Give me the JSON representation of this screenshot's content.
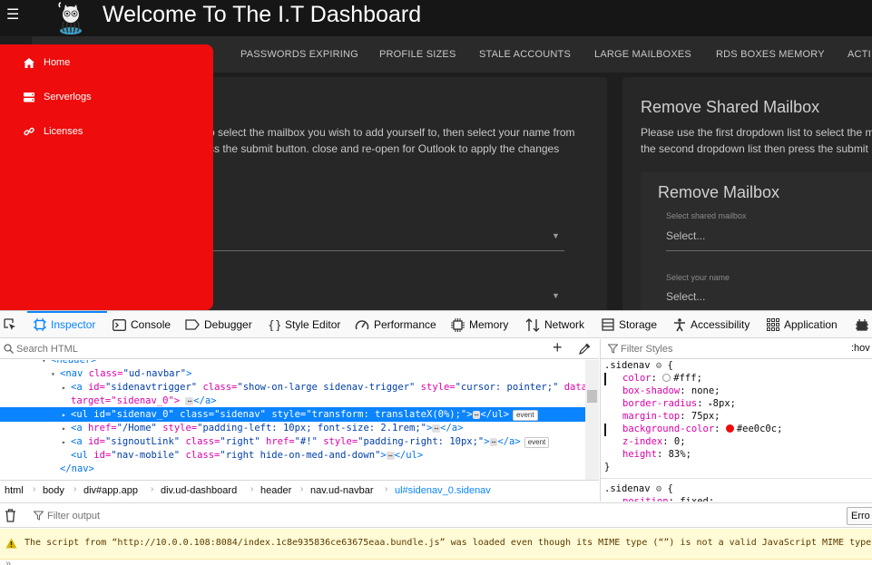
{
  "page": {
    "title": "Welcome To The I.T Dashboard",
    "tabs": [
      "PASSWORDS EXPIRING",
      "PROFILE SIZES",
      "STALE ACCOUNTS",
      "LARGE MAILBOXES",
      "RDS BOXES MEMORY",
      "ACTI"
    ],
    "sidenav": [
      {
        "label": "Home",
        "icon": "home-icon"
      },
      {
        "label": "Serverlogs",
        "icon": "server-icon"
      },
      {
        "label": "Licenses",
        "icon": "link-icon"
      }
    ],
    "left_card": {
      "line1": "o select the mailbox you wish to add yourself to, then select your name from",
      "line2": "ss the submit button. close and re-open for Outlook to apply the changes"
    },
    "right_card": {
      "title": "Remove Shared Mailbox",
      "line1": "Please use the first dropdown list to select the m",
      "line2": "the second dropdown list then press the submit",
      "subtitle": "Remove Mailbox",
      "field1_label": "Select shared mailbox",
      "field1_value": "Select...",
      "field2_label": "Select your name",
      "field2_value": "Select..."
    }
  },
  "devtools": {
    "tabs": [
      "Inspector",
      "Console",
      "Debugger",
      "Style Editor",
      "Performance",
      "Memory",
      "Network",
      "Storage",
      "Accessibility",
      "Application"
    ],
    "active_tab": "Inspector",
    "search_placeholder": "Search HTML",
    "filter_styles_placeholder": "Filter Styles",
    "hov_label": ":hov",
    "tree": [
      {
        "indent": 0,
        "twisty": "▾",
        "open": "<header>",
        "rest": ""
      },
      {
        "indent": 1,
        "twisty": "▾",
        "open": "<nav",
        "attrs": [
          [
            "class",
            "ud-navbar"
          ]
        ],
        "close": ">"
      },
      {
        "indent": 2,
        "twisty": "▸",
        "open": "<a",
        "attrs": [
          [
            "id",
            "sidenavtrigger"
          ],
          [
            "class",
            "show-on-large sidenav-trigger"
          ],
          [
            "style",
            "cursor: pointer;"
          ],
          [
            "data-",
            ""
          ]
        ],
        "close": ""
      },
      {
        "indent": 2,
        "twisty": "",
        "text": "target=\"sidenav_0\">",
        "tail": "</a>"
      },
      {
        "indent": 2,
        "twisty": "▸",
        "open": "<ul",
        "attrs": [
          [
            "id",
            "sidenav_0"
          ],
          [
            "class",
            "sidenav"
          ],
          [
            "style",
            "transform: translateX(0%);"
          ]
        ],
        "close": ">",
        "tail": "</ul>",
        "event": true,
        "selected": true
      },
      {
        "indent": 2,
        "twisty": "▸",
        "open": "<a",
        "attrs": [
          [
            "href",
            "/Home"
          ],
          [
            "style",
            "padding-left: 10px; font-size: 2.1rem;"
          ]
        ],
        "close": ">",
        "tail": "</a>"
      },
      {
        "indent": 2,
        "twisty": "▸",
        "open": "<a",
        "attrs": [
          [
            "id",
            "signoutLink"
          ],
          [
            "class",
            "right"
          ],
          [
            "href",
            "#!"
          ],
          [
            "style",
            "padding-right: 10px;"
          ]
        ],
        "close": ">",
        "tail": "</a>",
        "event": true
      },
      {
        "indent": 2,
        "twisty": "",
        "open": "<ul",
        "attrs": [
          [
            "id",
            "nav-mobile"
          ],
          [
            "class",
            "right hide-on-med-and-down"
          ]
        ],
        "close": ">",
        "tail": "</ul>"
      },
      {
        "indent": 1,
        "twisty": "",
        "open": "</nav>",
        "attrs": [],
        "close": ""
      }
    ],
    "event_label": "event",
    "breadcrumb": [
      "html",
      "body",
      "div#app.app",
      "div.ud-dashboard",
      "header",
      "nav.ud-navbar",
      "ul#sidenav_0.sidenav"
    ],
    "rules": {
      "selector1": ".sidenav",
      "props": [
        {
          "name": "color",
          "value": "#fff"
        },
        {
          "name": "box-shadow",
          "value": "none"
        },
        {
          "name": "border-radius",
          "value": "8px"
        },
        {
          "name": "margin-top",
          "value": "75px"
        },
        {
          "name": "background-color",
          "value": "#ee0c0c"
        },
        {
          "name": "z-index",
          "value": "0"
        },
        {
          "name": "height",
          "value": "83%"
        }
      ],
      "selector2": ".sidenav",
      "props2": [
        {
          "name": "position",
          "value": "fixed"
        }
      ]
    },
    "console": {
      "filter_placeholder": "Filter output",
      "errors_label": "Erro",
      "warning": "The script from “http://10.0.0.108:8084/index.1c8e935836ce63675eaa.bundle.js” was loaded even though its MIME type (“”) is not a valid JavaScript MIME type."
    }
  },
  "colors": {
    "accent": "#0a84ff",
    "sidenav": "#ee0c0c"
  }
}
